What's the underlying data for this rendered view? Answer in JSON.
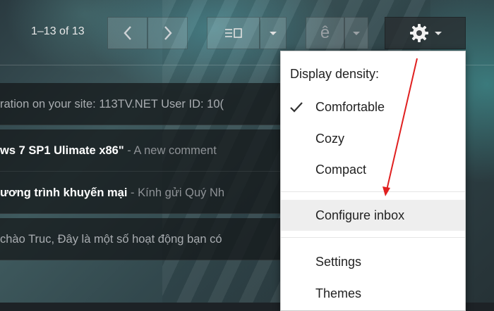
{
  "toolbar": {
    "pager_text": "1–13 of 13",
    "input_tool_glyph": "ê"
  },
  "emails": [
    {
      "bold": "",
      "snippet": "ration on your site: 113TV.NET User ID: 10(",
      "style": "light"
    },
    {
      "bold": "ws 7 SP1 Ulimate x86\"",
      "snippet": " - A new comment",
      "style": "bold"
    },
    {
      "bold": "ương trình khuyến mại",
      "snippet": " - Kính gửi Quý Nh",
      "style": "bold"
    },
    {
      "bold": "",
      "snippet": "chào Truc, Đây là một số hoạt động bạn có",
      "style": "light"
    }
  ],
  "settings_menu": {
    "heading": "Display density:",
    "items": [
      {
        "label": "Comfortable",
        "checked": true
      },
      {
        "label": "Cozy",
        "checked": false
      },
      {
        "label": "Compact",
        "checked": false
      },
      {
        "label": "Configure inbox",
        "checked": false,
        "highlighted": true
      },
      {
        "label": "Settings",
        "checked": false
      },
      {
        "label": "Themes",
        "checked": false
      }
    ]
  },
  "colors": {
    "annotation_arrow": "#e02020",
    "menu_background": "#ffffff",
    "menu_highlight": "#eeeeee"
  },
  "icons": [
    "chevron-left-icon",
    "chevron-right-icon",
    "split-pane-icon",
    "caret-down-icon",
    "gear-icon",
    "check-icon"
  ]
}
